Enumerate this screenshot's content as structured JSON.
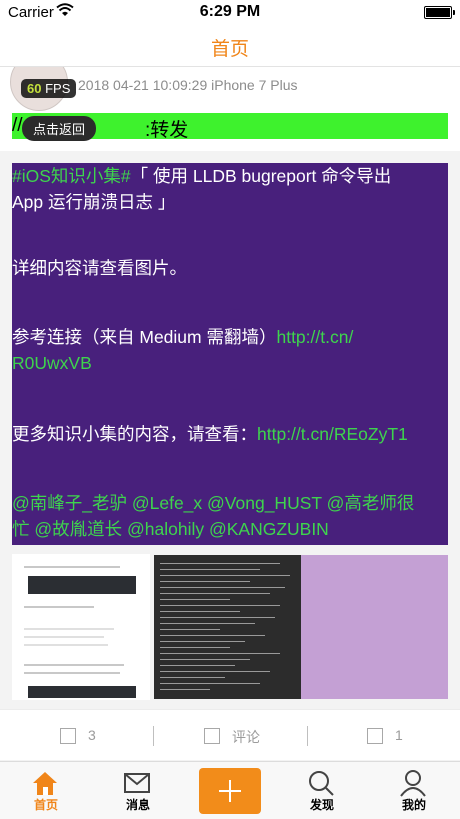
{
  "status_bar": {
    "carrier": "Carrier",
    "time": "6:29 PM"
  },
  "nav": {
    "title": "首页"
  },
  "post": {
    "meta": "2018 04-21 10:09:29  iPhone 7 Plus",
    "fps": {
      "value": "60",
      "unit": " FPS"
    },
    "retweet": {
      "prefix": "//",
      "suffix": ":转发"
    },
    "back_button": "点击返回",
    "body": {
      "topic": "#iOS知识小集#",
      "line1": "「 使用 LLDB bugreport 命令导出",
      "line2": "App 运行崩溃日志 」",
      "detail": "详细内容请查看图片。",
      "ref_text": "参考连接（来自 Medium 需翻墙）",
      "ref_link1": "http://t.cn/",
      "ref_link2": "R0UwxVB",
      "more_text": "更多知识小集的内容，请查看：",
      "more_link": "http://t.cn/REoZyT1",
      "mentions1": "@南峰子_老驴 @Lefe_x @Vong_HUST @高老师很",
      "mentions2": "忙 @故胤道长 @halohily @KANGZUBIN"
    },
    "actions": {
      "repost_count": "3",
      "comment_label": "评论",
      "like_count": "1"
    }
  },
  "tab_bar": {
    "home": "首页",
    "messages": "消息",
    "discover": "发现",
    "me": "我的"
  },
  "colors": {
    "accent": "#f08519",
    "retweet_bg": "#3ef22d",
    "body_bg": "#48207c",
    "link": "#3ed44d"
  }
}
